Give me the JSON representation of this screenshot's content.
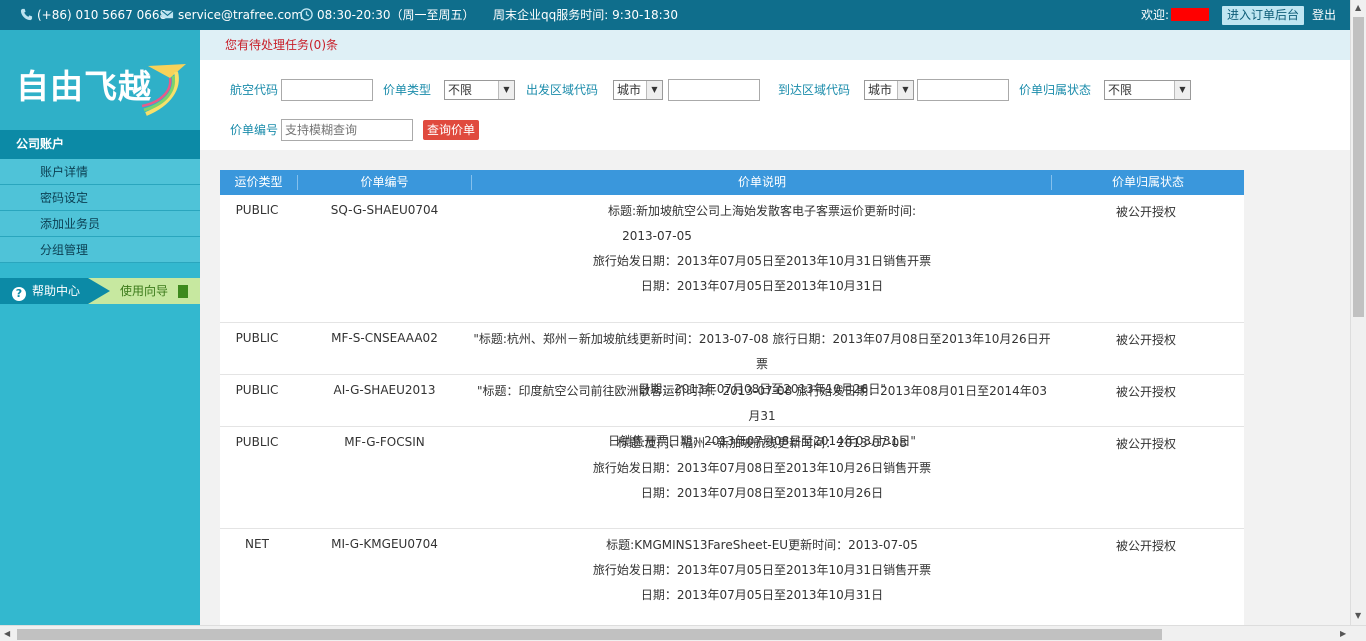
{
  "topbar": {
    "phone": "(+86) 010 5667 0668",
    "email": "service@trafree.com",
    "hours": "08:30-20:30（周一至周五）",
    "weekend": "周末企业qq服务时间: 9:30-18:30",
    "welcome": "欢迎:",
    "backend_btn": "进入订单后台",
    "logout": "登出"
  },
  "sidebar": {
    "logo": "自由飞越",
    "section": "公司账户",
    "items": [
      {
        "label": "账户详情"
      },
      {
        "label": "密码设定"
      },
      {
        "label": "添加业务员"
      },
      {
        "label": "分组管理"
      }
    ],
    "help": "帮助中心",
    "guide": "使用向导"
  },
  "notice": "您有待处理任务(0)条",
  "filters": {
    "airline_code": "航空代码",
    "price_type": "价单类型",
    "price_type_value": "不限",
    "depart_region": "出发区域代码",
    "depart_select": "城市",
    "arrive_region": "到达区域代码",
    "arrive_select": "城市",
    "ownership": "价单归属状态",
    "ownership_value": "不限",
    "price_no": "价单编号",
    "price_no_placeholder": "支持模糊查询",
    "query_btn": "查询价单"
  },
  "table": {
    "headers": [
      "运价类型",
      "价单编号",
      "价单说明",
      "价单归属状态"
    ],
    "rows": [
      {
        "type": "PUBLIC",
        "code": "SQ-G-SHAEU0704",
        "lines": [
          "标题:新加坡航空公司上海始发散客电子客票运价更新时间:",
          "2013-07-05",
          "旅行始发日期：2013年07月05日至2013年10月31日销售开票",
          "日期：2013年07月05日至2013年10月31日"
        ],
        "status": "被公开授权"
      },
      {
        "type": "PUBLIC",
        "code": "MF-S-CNSEAAA02",
        "lines": [
          "\"标题:杭州、郑州－新加坡航线更新时间：2013-07-08 旅行日期：2013年07月08日至2013年10月26日开票",
          "日期：2013年07月08日至2013年10月26日\""
        ],
        "status": "被公开授权"
      },
      {
        "type": "PUBLIC",
        "code": "AI-G-SHAEU2013",
        "lines": [
          "\"标题：印度航空公司前往欧洲散客运价时间：2013-07-08 旅行始发日期：2013年08月01日至2014年03月31",
          "日销售开票日期：2013年07月08日至2014年03月31日\""
        ],
        "status": "被公开授权"
      },
      {
        "type": "PUBLIC",
        "code": "MF-G-FOCSIN",
        "lines": [
          "标题:厦门、福州－新加坡航线更新时间：2013-07-08",
          "旅行始发日期：2013年07月08日至2013年10月26日销售开票",
          "日期：2013年07月08日至2013年10月26日"
        ],
        "status": "被公开授权"
      },
      {
        "type": "NET",
        "code": "MI-G-KMGEU0704",
        "lines": [
          "标题:KMGMINS13FareSheet-EU更新时间：2013-07-05",
          "旅行始发日期：2013年07月05日至2013年10月31日销售开票",
          "日期：2013年07月05日至2013年10月31日"
        ],
        "status": "被公开授权"
      }
    ]
  },
  "colors": {
    "topbar": "#0f6e8c",
    "sidebar": "#33b8cf",
    "header": "#3a97dc",
    "notice_text": "#c8202a",
    "query_btn": "#e04a3e"
  }
}
